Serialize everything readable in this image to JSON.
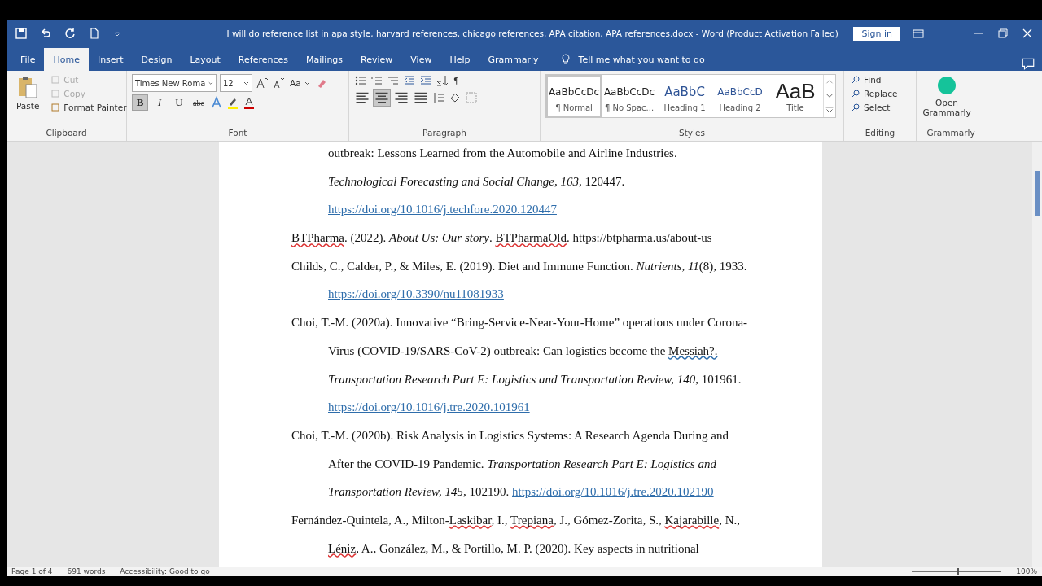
{
  "window": {
    "title": "I will do reference list in apa style, harvard references, chicago references, APA citation, APA references.docx  -  Word (Product Activation Failed)",
    "sign_in": "Sign in"
  },
  "tabs": [
    {
      "label": "File",
      "selected": false
    },
    {
      "label": "Home",
      "selected": true
    },
    {
      "label": "Insert",
      "selected": false
    },
    {
      "label": "Design",
      "selected": false
    },
    {
      "label": "Layout",
      "selected": false
    },
    {
      "label": "References",
      "selected": false
    },
    {
      "label": "Mailings",
      "selected": false
    },
    {
      "label": "Review",
      "selected": false
    },
    {
      "label": "View",
      "selected": false
    },
    {
      "label": "Help",
      "selected": false
    },
    {
      "label": "Grammarly",
      "selected": false
    }
  ],
  "tell_me": {
    "placeholder": "Tell me what you want to do"
  },
  "clipboard": {
    "paste": "Paste",
    "actions": [
      {
        "label": "Cut",
        "disabled": true
      },
      {
        "label": "Copy",
        "disabled": true
      },
      {
        "label": "Format Painter",
        "disabled": false
      }
    ],
    "group": "Clipboard"
  },
  "font": {
    "name": "Times New Roma",
    "size": "12",
    "case": "Aa",
    "format_buttons": [
      {
        "label": "B",
        "kind": "bold",
        "selected": true
      },
      {
        "label": "I",
        "kind": "italic",
        "selected": false
      },
      {
        "label": "U",
        "kind": "underline",
        "selected": false
      },
      {
        "label": "abc",
        "kind": "strike",
        "selected": false
      }
    ],
    "group": "Font"
  },
  "paragraph": {
    "alignments": [
      {
        "kind": "left",
        "selected": false
      },
      {
        "kind": "center",
        "selected": true
      },
      {
        "kind": "right",
        "selected": false
      },
      {
        "kind": "justify",
        "selected": false
      }
    ],
    "pilcrow": "¶",
    "group": "Paragraph"
  },
  "styles": {
    "items": [
      {
        "preview": "AaBbCcDc",
        "name": "¶ Normal",
        "kind": "normal",
        "selected": true
      },
      {
        "preview": "AaBbCcDc",
        "name": "¶ No Spac...",
        "kind": "normal",
        "selected": false
      },
      {
        "preview": "AaBbC",
        "name": "Heading 1",
        "kind": "heading1",
        "selected": false
      },
      {
        "preview": "AaBbCcD",
        "name": "Heading 2",
        "kind": "heading2",
        "selected": false
      },
      {
        "preview": "AaB",
        "name": "Title",
        "kind": "title",
        "selected": false
      }
    ],
    "group": "Styles"
  },
  "editing": {
    "actions": [
      "Find",
      "Replace",
      "Select"
    ],
    "group": "Editing"
  },
  "grammarly": {
    "button": "Open Grammarly",
    "group": "Grammarly"
  },
  "document": {
    "continued_lines": [
      [
        {
          "kind": "plain",
          "text": "outbreak: Lessons Learned from the Automobile and Airline Industries."
        }
      ],
      [
        {
          "kind": "italic",
          "text": "Technological Forecasting and Social Change, 163"
        },
        {
          "kind": "plain",
          "text": ", 120447."
        }
      ],
      [
        {
          "kind": "link",
          "text": "https://doi.org/10.1016/j.techfore.2020.120447"
        }
      ]
    ],
    "references": [
      {
        "lines": [
          [
            {
              "kind": "spelling",
              "text": "BTPharma"
            },
            {
              "kind": "plain",
              "text": ". (2022). "
            },
            {
              "kind": "italic",
              "text": "About Us: Our story"
            },
            {
              "kind": "plain",
              "text": ". "
            },
            {
              "kind": "spelling",
              "text": "BTPharmaOld"
            },
            {
              "kind": "plain",
              "text": ". https://btpharma.us/about-us"
            }
          ]
        ]
      },
      {
        "lines": [
          [
            {
              "kind": "plain",
              "text": "Childs, C., Calder, P., & Miles, E. (2019). Diet and Immune Function. "
            },
            {
              "kind": "italic",
              "text": "Nutrients, 11"
            },
            {
              "kind": "plain",
              "text": "(8), 1933."
            }
          ],
          [
            {
              "kind": "link",
              "text": "https://doi.org/10.3390/nu11081933"
            }
          ]
        ]
      },
      {
        "lines": [
          [
            {
              "kind": "plain",
              "text": "Choi, T.-M. (2020a). Innovative “Bring-Service-Near-Your-Home” operations under Corona-"
            }
          ],
          [
            {
              "kind": "plain",
              "text": "Virus (COVID-19/SARS-CoV-2) outbreak: Can logistics become the "
            },
            {
              "kind": "grammar",
              "text": "Messiah?."
            }
          ],
          [
            {
              "kind": "italic",
              "text": "Transportation Research Part E: Logistics and Transportation Review, 140"
            },
            {
              "kind": "plain",
              "text": ", 101961."
            }
          ],
          [
            {
              "kind": "link",
              "text": "https://doi.org/10.1016/j.tre.2020.101961"
            }
          ]
        ]
      },
      {
        "lines": [
          [
            {
              "kind": "plain",
              "text": "Choi, T.-M. (2020b). Risk Analysis in Logistics Systems: A Research Agenda During and"
            }
          ],
          [
            {
              "kind": "plain",
              "text": "After the COVID-19 Pandemic. "
            },
            {
              "kind": "italic",
              "text": "Transportation Research Part E: Logistics and"
            }
          ],
          [
            {
              "kind": "italic",
              "text": "Transportation Review, 145"
            },
            {
              "kind": "plain",
              "text": ", 102190. "
            },
            {
              "kind": "link",
              "text": "https://doi.org/10.1016/j.tre.2020.102190"
            }
          ]
        ]
      },
      {
        "lines": [
          [
            {
              "kind": "plain",
              "text": "Fernández-Quintela, A., Milton-"
            },
            {
              "kind": "spelling",
              "text": "Laskibar"
            },
            {
              "kind": "plain",
              "text": ", I., "
            },
            {
              "kind": "spelling",
              "text": "Trepiana"
            },
            {
              "kind": "plain",
              "text": ", J., Gómez-Zorita, S., "
            },
            {
              "kind": "spelling",
              "text": "Kajarabille"
            },
            {
              "kind": "plain",
              "text": ", N.,"
            }
          ],
          [
            {
              "kind": "spelling",
              "text": "Léniz"
            },
            {
              "kind": "plain",
              "text": ", A., González, M., & Portillo, M. P. (2020). Key aspects in nutritional"
            }
          ]
        ]
      }
    ]
  },
  "status_bar": {
    "page": "Page 1 of 4",
    "words": "691 words",
    "accessibility": "Accessibility: Good to go",
    "zoom": "100%",
    "zoom_slider": {
      "level": 0.5
    }
  }
}
